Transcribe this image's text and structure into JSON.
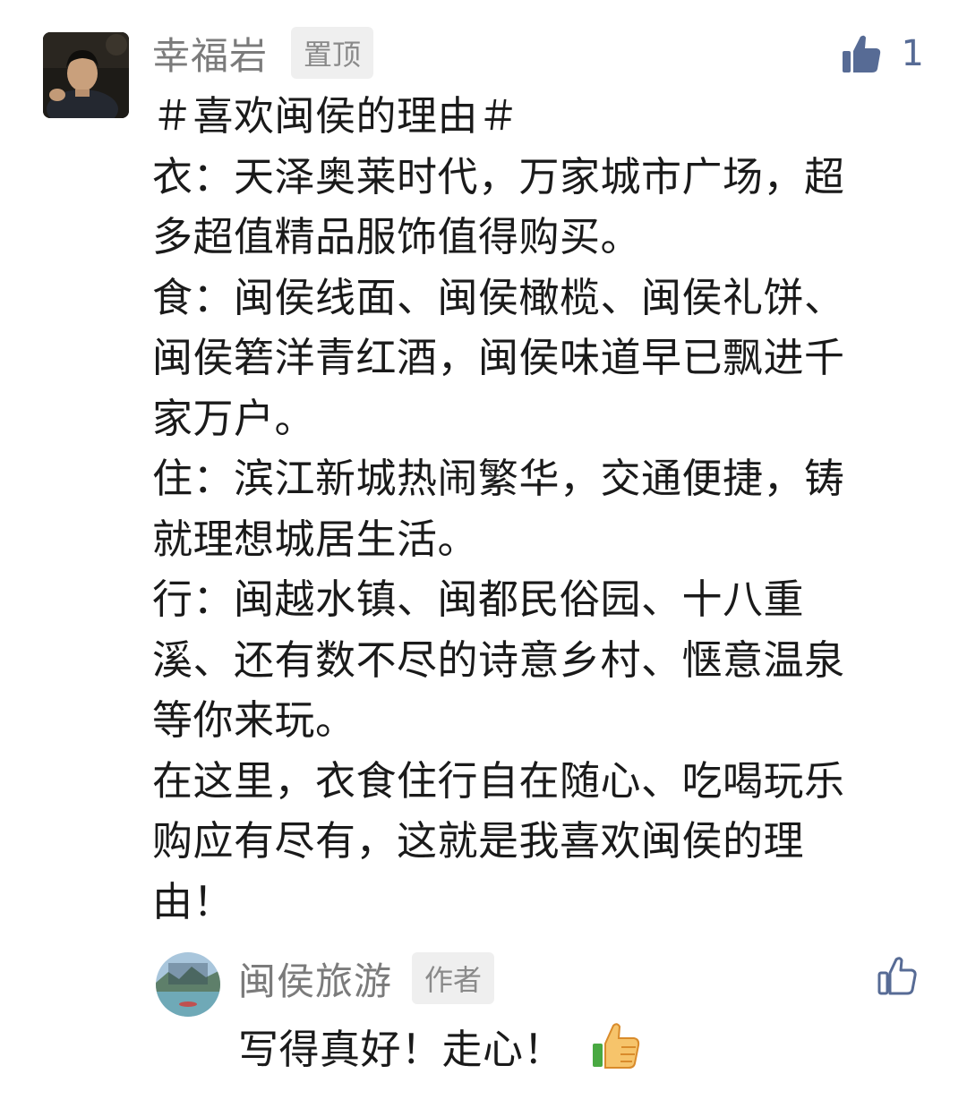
{
  "comment": {
    "username": "幸福岩",
    "badge": "置顶",
    "like_count": "1",
    "icons": {
      "like": "thumbs-up-filled-icon"
    },
    "body_lines": [
      "＃喜欢闽侯的理由＃",
      "衣：天泽奥莱时代，万家城市广场，超",
      "多超值精品服饰值得购买。",
      "食：闽侯线面、闽侯橄榄、闽侯礼饼、",
      "闽侯箬洋青红酒，闽侯味道早已飘进千",
      "家万户。",
      "住：滨江新城热闹繁华，交通便捷，铸",
      "就理想城居生活。",
      "行：闽越水镇、闽都民俗园、十八重",
      "溪、还有数不尽的诗意乡村、惬意温泉",
      "等你来玩。",
      "在这里，衣食住行自在随心、吃喝玩乐",
      "购应有尽有，这就是我喜欢闽侯的理",
      "由！"
    ]
  },
  "reply": {
    "username": "闽侯旅游",
    "badge": "作者",
    "text": "写得真好！走心！",
    "avatar_text": "闽侯旅游",
    "icons": {
      "like": "thumbs-up-outline-icon",
      "emoji": "thumbs-up-emoji"
    }
  },
  "colors": {
    "link_blue": "#576b95",
    "name_gray": "#7b7b7b",
    "badge_bg": "#efefef",
    "text": "#1a1a1a"
  }
}
